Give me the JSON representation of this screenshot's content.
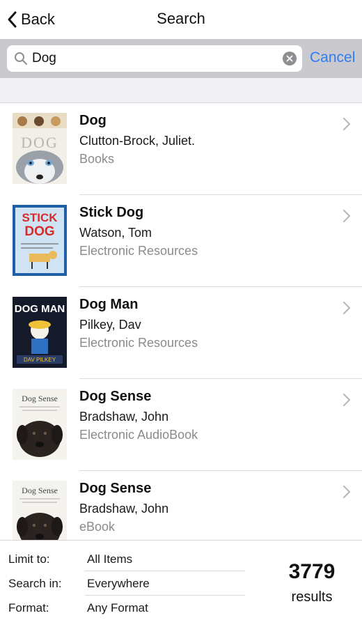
{
  "nav": {
    "back_label": "Back",
    "title": "Search"
  },
  "search": {
    "value": "Dog",
    "cancel_label": "Cancel"
  },
  "results": [
    {
      "title": "Dog",
      "author": "Clutton-Brock, Juliet.",
      "format": "Books",
      "cover_text": "DOG"
    },
    {
      "title": "Stick Dog",
      "author": "Watson, Tom",
      "format": "Electronic Resources",
      "cover_text": "STICK DOG"
    },
    {
      "title": "Dog Man",
      "author": "Pilkey, Dav",
      "format": "Electronic Resources",
      "cover_text": "DOG MAN"
    },
    {
      "title": "Dog Sense",
      "author": "Bradshaw, John",
      "format": "Electronic AudioBook",
      "cover_text": "Dog Sense"
    },
    {
      "title": "Dog Sense",
      "author": "Bradshaw, John",
      "format": "eBook",
      "cover_text": "Dog Sense"
    }
  ],
  "filters": {
    "limit": {
      "label": "Limit to:",
      "value": "All Items"
    },
    "search_in": {
      "label": "Search in:",
      "value": "Everywhere"
    },
    "format": {
      "label": "Format:",
      "value": "Any Format"
    }
  },
  "summary": {
    "count": "3779",
    "label": "results"
  },
  "colors": {
    "accent": "#2f7cf6",
    "searchbar_bg": "#c9c9ce",
    "secondary_text": "#8a8a8f"
  }
}
